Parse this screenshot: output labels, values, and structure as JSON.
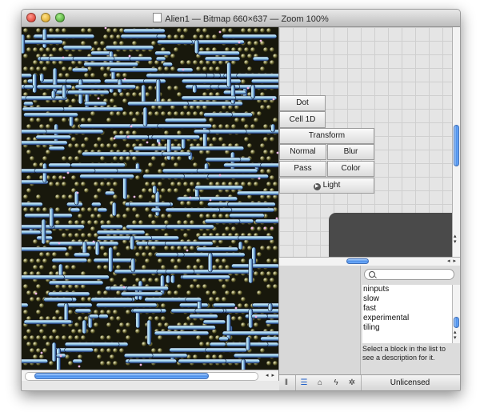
{
  "window": {
    "title": "Alien1 — Bitmap 660×637 — Zoom 100%",
    "doc_icon": "bitmap-document-icon"
  },
  "canvas": {
    "palette": {
      "background": "#18180c",
      "metal": "#9bd2ee",
      "highlight": "#e8f7ff",
      "shadow": "#1f3c86",
      "olive": "#6d6a34",
      "accent": "#f2b7e6"
    }
  },
  "blocks": {
    "dot": "Dot",
    "cell1d": "Cell 1D",
    "transform": "Transform",
    "normal": "Normal",
    "blur": "Blur",
    "pass": "Pass",
    "color": "Color",
    "light": "Light",
    "light_icon": "play-circle-icon"
  },
  "library": {
    "search_placeholder": "",
    "items": [
      "ninputs",
      "slow",
      "fast",
      "experimental",
      "tiling"
    ],
    "description": "Select a block in the list to see a description for it."
  },
  "toolbar": {
    "icons": [
      "columns-icon",
      "list-icon",
      "house-icon",
      "bolt-icon",
      "gear-icon"
    ],
    "status": "Unlicensed"
  },
  "scroll": {
    "canvas_h_fraction": 0.75,
    "graph_v_fraction": 0.45,
    "graph_h_fraction": 0.4,
    "list_v_fraction": 0.6
  },
  "colors": {
    "accent": "#4b8ee8",
    "window": "#ececec",
    "grid": "#cfcfcf"
  }
}
